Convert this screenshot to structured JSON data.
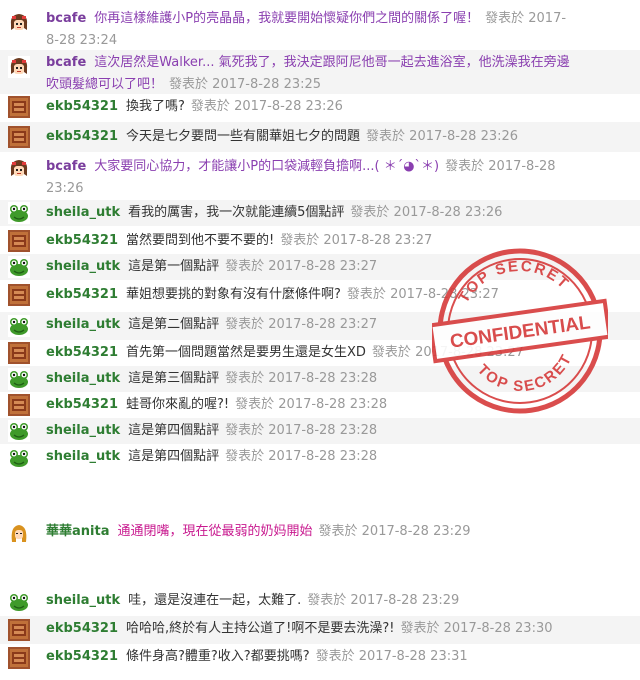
{
  "colors": {
    "bcafe": "#7a3e9d",
    "ekb": "#2e7d32",
    "sheila": "#2e7d32",
    "anita": "#2e7d32",
    "msg_purple": "#8a3fb0",
    "msg_magenta": "#c8198f",
    "msg_default": "#333333",
    "timestamp": "#999999",
    "stamp_red": "#d63a3a"
  },
  "posted_label": "發表於",
  "messages": [
    {
      "user": "bcafe",
      "avatar": "girl-avatar-icon",
      "text": "你再這樣維護小P的亮晶晶，我就要開始懷疑你們之間的關係了喔！",
      "time_line1": "2017-",
      "time_line2": "8-28 23:24"
    },
    {
      "user": "bcafe",
      "avatar": "girl-avatar-icon",
      "text_line1": "這次居然是Walker... 氣死我了，我決定跟阿尼他哥一起去進浴室，他洗澡我在旁邊",
      "text_line2": "吹頭髮總可以了吧！",
      "time": "2017-8-28 23:25"
    },
    {
      "user": "ekb54321",
      "avatar": "stone-avatar-icon",
      "text": "換我了嗎?",
      "time": "2017-8-28 23:26"
    },
    {
      "user": "ekb54321",
      "avatar": "stone-avatar-icon",
      "text": "今天是七夕要問一些有關華姐七夕的問題",
      "time": "2017-8-28 23:26"
    },
    {
      "user": "bcafe",
      "avatar": "girl-avatar-icon",
      "text": "大家要同心協力，才能讓小P的口袋減輕負擔啊...( ＊´◕`＊)",
      "time_line1": "2017-8-28",
      "time_line2": "23:26"
    },
    {
      "user": "sheila_utk",
      "avatar": "frog-avatar-icon",
      "text": "看我的厲害，我一次就能連續5個點評",
      "time": "2017-8-28 23:26"
    },
    {
      "user": "ekb54321",
      "avatar": "stone-avatar-icon",
      "text": "當然要問到他不要不要的!",
      "time": "2017-8-28 23:27"
    },
    {
      "user": "sheila_utk",
      "avatar": "frog-avatar-icon",
      "text": "這是第一個點評",
      "time": "2017-8-28 23:27"
    },
    {
      "user": "ekb54321",
      "avatar": "stone-avatar-icon",
      "text": "華姐想要挑的對象有沒有什麼條件啊?",
      "time": "2017-8-28 23:27"
    },
    {
      "user": "sheila_utk",
      "avatar": "frog-avatar-icon",
      "text": "這是第二個點評",
      "time": "2017-8-28 23:27"
    },
    {
      "user": "ekb54321",
      "avatar": "stone-avatar-icon",
      "text": "首先第一個問題當然是要男生還是女生XD",
      "time": "2017-8-28 23:27"
    },
    {
      "user": "sheila_utk",
      "avatar": "frog-avatar-icon",
      "text": "這是第三個點評",
      "time": "2017-8-28 23:28"
    },
    {
      "user": "ekb54321",
      "avatar": "stone-avatar-icon",
      "text": "蛙哥你來亂的喔?!",
      "time": "2017-8-28 23:28"
    },
    {
      "user": "sheila_utk",
      "avatar": "frog-avatar-icon",
      "text": "這是第四個點評",
      "time": "2017-8-28 23:28"
    },
    {
      "user": "sheila_utk",
      "avatar": "frog-avatar-icon",
      "text": "這是第四個點評",
      "time": "2017-8-28 23:28"
    },
    {
      "user": "華華anita",
      "avatar": "anita-avatar-icon",
      "text": "通通閉嘴，現在從最弱的奶妈開始",
      "time": "2017-8-28 23:29"
    },
    {
      "user": "sheila_utk",
      "avatar": "frog-avatar-icon",
      "text": "哇，還是沒連在一起，太難了.",
      "time": "2017-8-28 23:29"
    },
    {
      "user": "ekb54321",
      "avatar": "stone-avatar-icon",
      "text": "哈哈哈,終於有人主持公道了!啊不是要去洗澡?!",
      "time": "2017-8-28 23:30"
    },
    {
      "user": "ekb54321",
      "avatar": "stone-avatar-icon",
      "text": "條件身高?體重?收入?都要挑嗎?",
      "time": "2017-8-28 23:31"
    }
  ],
  "stamp": {
    "top_text": "TOP SECRET",
    "middle_text": "CONFIDENTIAL",
    "bottom_text": "TOP SECRET"
  }
}
